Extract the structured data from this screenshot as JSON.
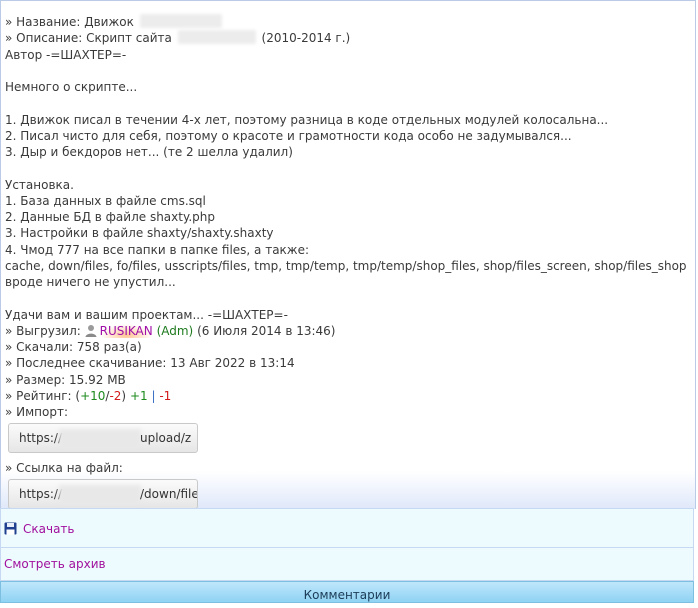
{
  "file_info": {
    "name_label": "» Название: Движок",
    "description_label": "» Описание: Скрипт сайта",
    "description_years": "(2010-2014 г.)",
    "author": "Автор -=ШАХТЕР=-",
    "about_heading": "Немного о скрипте...",
    "about_items": [
      "1. Движок писал в течении 4-х лет, поэтому разница в коде отдельных модулей колосальна...",
      "2. Писал чисто для себя, поэтому о красоте и грамотности кода особо не задумывался...",
      "3. Дыр и бекдоров нет... (те 2 шелла удалил)"
    ],
    "install_heading": "Установка.",
    "install_items": [
      "1. База данных в файле cms.sql",
      "2. Данные БД в файле shaxty.php",
      "3. Настройки в файле shaxty/shaxty.shaxty",
      "4. Чмод 777 на все папки в папке files, а также:",
      "cache, down/files, fo/files, usscripts/files, tmp, tmp/temp, tmp/temp/shop_files, shop/files_screen, shop/files_shop",
      "вроде ничего не упустил..."
    ],
    "farewell": "Удачи вам и вашим проектам... -=ШАХТЕР=-",
    "uploaded_label": "» Выгрузил:",
    "uploader_name": "RUSIKAN",
    "uploader_role": "(Adm)",
    "upload_date": "(6 Июля 2014 в 13:46)",
    "downloads": "» Скачали: 758 раз(а)",
    "last_download": "» Последнее скачивание: 13 Авг 2022 в 13:14",
    "size": "» Размер: 15.92 MB",
    "rating_label": "» Рейтинг:",
    "rating_open": "(",
    "rating_plus": "+10",
    "rating_slash": "/",
    "rating_minus": "-2",
    "rating_close": ")",
    "rating_plus_one": "+1",
    "rating_divider": "|",
    "rating_minus_one": "-1",
    "import_label": "» Импорт:",
    "import_url_start": "https://",
    "import_url_end": "upload/z",
    "link_label": "» Ссылка на файл:",
    "link_url_start": "https://",
    "link_url_end": "/down/file"
  },
  "actions": {
    "download": "Скачать",
    "view_archive": "Смотреть архив",
    "comments": "Комментарии"
  },
  "icons": {
    "user": "user-icon",
    "save": "floppy-disk-icon"
  },
  "colors": {
    "link": "#a0109d",
    "admin": "#a00fa8",
    "role": "#1e7a1e",
    "positive": "#1d8a1d",
    "negative": "#d21a1a"
  }
}
